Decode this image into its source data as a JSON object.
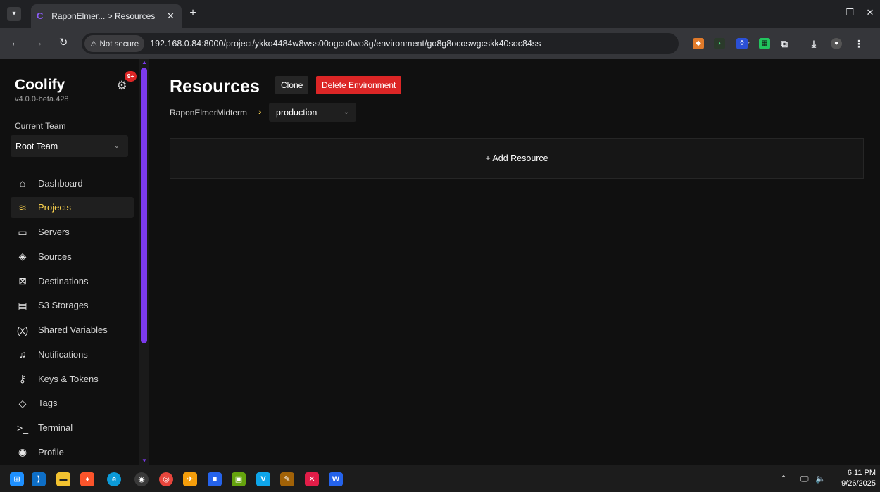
{
  "browser": {
    "tab_title": "RaponElmer... > Resources | Co",
    "tab_close": "✕",
    "new_tab": "+",
    "security_label": "⚠ Not secure",
    "url": "192.168.0.84:8000/project/ykko4484w8wss00ogco0wo8g/environment/go8g8ocoswgcskk40soc84ss"
  },
  "sidebar": {
    "brand": "Coolify",
    "version": "v4.0.0-beta.428",
    "notifications_badge": "9+",
    "team_label": "Current Team",
    "team_value": "Root Team",
    "items": [
      {
        "label": "Dashboard",
        "icon": "home-icon",
        "glyph": "⌂"
      },
      {
        "label": "Projects",
        "icon": "layers-icon",
        "glyph": "≋",
        "active": true
      },
      {
        "label": "Servers",
        "icon": "server-icon",
        "glyph": "▭"
      },
      {
        "label": "Sources",
        "icon": "git-icon",
        "glyph": "◈"
      },
      {
        "label": "Destinations",
        "icon": "destination-icon",
        "glyph": "⊠"
      },
      {
        "label": "S3 Storages",
        "icon": "database-icon",
        "glyph": "▤"
      },
      {
        "label": "Shared Variables",
        "icon": "variable-icon",
        "glyph": "(x)"
      },
      {
        "label": "Notifications",
        "icon": "bell-icon",
        "glyph": "♫"
      },
      {
        "label": "Keys & Tokens",
        "icon": "key-icon",
        "glyph": "⚷"
      },
      {
        "label": "Tags",
        "icon": "tag-icon",
        "glyph": "◇"
      },
      {
        "label": "Terminal",
        "icon": "terminal-icon",
        "glyph": ">_"
      },
      {
        "label": "Profile",
        "icon": "profile-icon",
        "glyph": "◉"
      }
    ]
  },
  "main": {
    "title": "Resources",
    "clone_label": "Clone",
    "delete_label": "Delete Environment",
    "breadcrumb_project": "RaponElmerMidterm",
    "breadcrumb_separator": "›",
    "environment": "production",
    "add_resource_label": "+ Add Resource"
  },
  "taskbar": {
    "time": "6:11 PM",
    "date": "9/26/2025"
  },
  "colors": {
    "accent": "#7c3aed",
    "active_nav": "#fcd34d",
    "danger": "#dc2626"
  }
}
